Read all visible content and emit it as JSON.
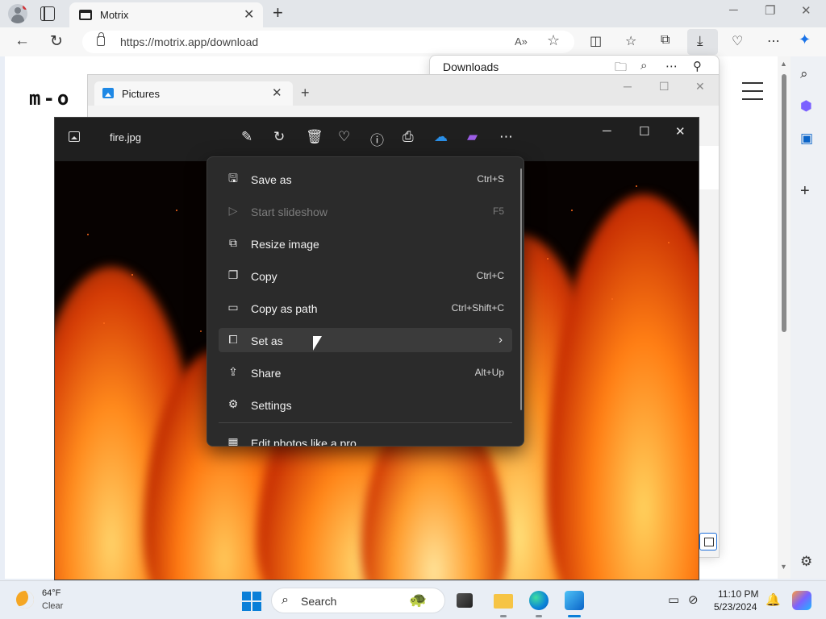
{
  "browser": {
    "tab_title": "Motrix",
    "url": "https://motrix.app/download",
    "tab_close": "✕",
    "new_tab": "+",
    "back": "←",
    "refresh": "↻"
  },
  "page": {
    "logo": "m-o"
  },
  "downloads": {
    "title": "Downloads"
  },
  "explorer": {
    "tab_title": "Pictures",
    "close": "✕",
    "new_tab": "+"
  },
  "photos": {
    "filename": "fire.jpg"
  },
  "context_menu": {
    "items": [
      {
        "label": "Save as",
        "shortcut": "Ctrl+S",
        "icon": "save-icon",
        "disabled": false
      },
      {
        "label": "Start slideshow",
        "shortcut": "F5",
        "icon": "slideshow-icon",
        "disabled": true
      },
      {
        "label": "Resize image",
        "shortcut": "",
        "icon": "resize-icon",
        "disabled": false
      },
      {
        "label": "Copy",
        "shortcut": "Ctrl+C",
        "icon": "copy-icon",
        "disabled": false
      },
      {
        "label": "Copy as path",
        "shortcut": "Ctrl+Shift+C",
        "icon": "copy-path-icon",
        "disabled": false
      },
      {
        "label": "Set as",
        "shortcut": "",
        "icon": "set-as-icon",
        "disabled": false,
        "submenu": true
      },
      {
        "label": "Share",
        "shortcut": "Alt+Up",
        "icon": "share-icon",
        "disabled": false
      },
      {
        "label": "Settings",
        "shortcut": "",
        "icon": "settings-icon",
        "disabled": false
      },
      {
        "label": "Edit photos like a pro",
        "shortcut": "",
        "icon": "store-icon",
        "disabled": false
      }
    ]
  },
  "taskbar": {
    "weather_temp": "64°F",
    "weather_condition": "Clear",
    "search_label": "Search",
    "time": "11:10 PM",
    "date": "5/23/2024"
  },
  "colors": {
    "accent": "#0a7fd8",
    "menu_bg": "#2b2b2b",
    "photos_bar": "#1f1f1f"
  }
}
